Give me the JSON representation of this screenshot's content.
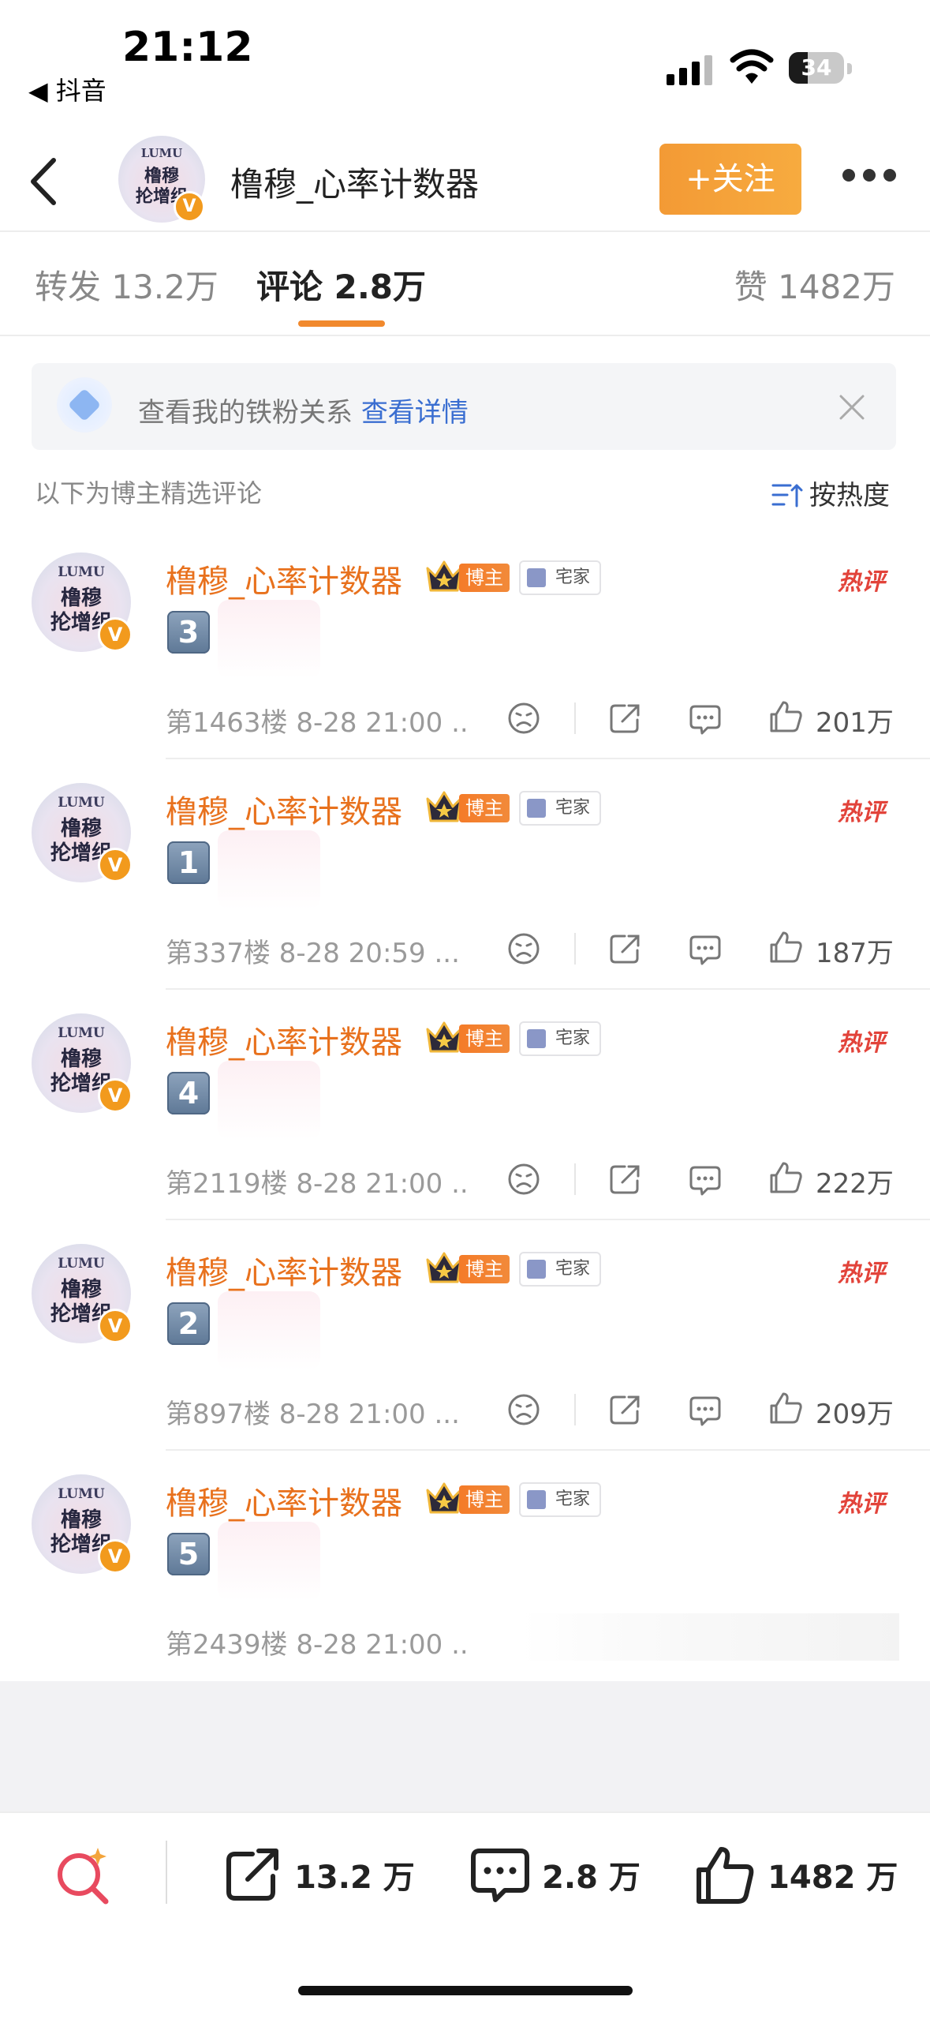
{
  "status_bar": {
    "time": "21:12",
    "back_app": "◀ 抖音",
    "battery": "34",
    "battery_level": 0.34
  },
  "header": {
    "account_name": "橹穆_心率计数器",
    "follow_label": "+关注",
    "avatar": {
      "line1": "LUMU",
      "line2": "橹穆",
      "line3": "抡增组"
    }
  },
  "tabs": [
    {
      "label": "转发 13.2万"
    },
    {
      "label": "评论 2.8万"
    },
    {
      "label": "赞 1482万"
    }
  ],
  "banner": {
    "text": "查看我的铁粉关系",
    "link": "查看详情"
  },
  "section": {
    "tip": "以下为博主精选评论",
    "sort_label": "按热度"
  },
  "comments": [
    {
      "name": "橹穆_心率计数器",
      "blogger_tag": "博主",
      "home_tag": "宅家",
      "hot_label": "热评",
      "number_emoji": "3",
      "meta": "第1463楼 8-28 21:00 ..",
      "likes": "201万"
    },
    {
      "name": "橹穆_心率计数器",
      "blogger_tag": "博主",
      "home_tag": "宅家",
      "hot_label": "热评",
      "number_emoji": "1",
      "meta": "第337楼 8-28 20:59 ...",
      "likes": "187万"
    },
    {
      "name": "橹穆_心率计数器",
      "blogger_tag": "博主",
      "home_tag": "宅家",
      "hot_label": "热评",
      "number_emoji": "4",
      "meta": "第2119楼 8-28 21:00 ..",
      "likes": "222万"
    },
    {
      "name": "橹穆_心率计数器",
      "blogger_tag": "博主",
      "home_tag": "宅家",
      "hot_label": "热评",
      "number_emoji": "2",
      "meta": "第897楼 8-28 21:00 ...",
      "likes": "209万"
    },
    {
      "name": "橹穆_心率计数器",
      "blogger_tag": "博主",
      "home_tag": "宅家",
      "hot_label": "热评",
      "number_emoji": "5",
      "meta": "第2439楼 8-28 21:00 ..",
      "likes": ""
    }
  ],
  "bottom_bar": {
    "repost_count": "13.2 万",
    "comment_count": "2.8 万",
    "like_count": "1482 万"
  },
  "colors": {
    "accent_orange": "#e8711d",
    "follow_button": "#f39a35",
    "hot_red": "#e2433a",
    "link_blue": "#3a6ed1"
  }
}
